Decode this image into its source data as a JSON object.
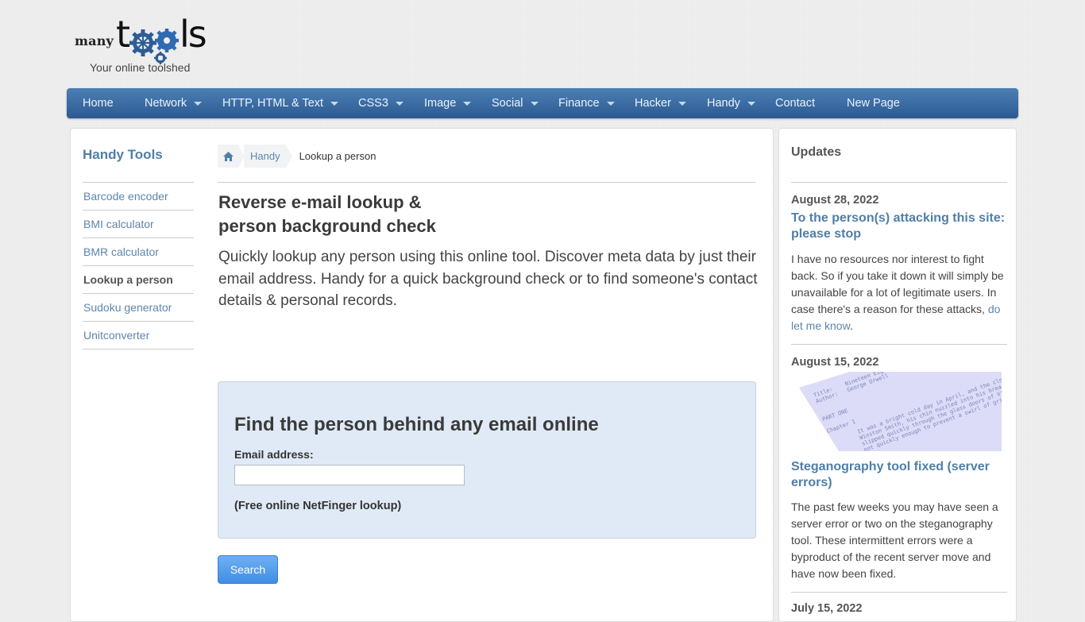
{
  "logo": {
    "word_many": "many",
    "word_t": "t",
    "word_ls": "ls",
    "tagline": "Your online toolshed"
  },
  "nav": {
    "items": [
      {
        "label": "Home",
        "dropdown": false
      },
      {
        "label": "Network",
        "dropdown": true
      },
      {
        "label": "HTTP, HTML & Text",
        "dropdown": true
      },
      {
        "label": "CSS3",
        "dropdown": true
      },
      {
        "label": "Image",
        "dropdown": true
      },
      {
        "label": "Social",
        "dropdown": true
      },
      {
        "label": "Finance",
        "dropdown": true
      },
      {
        "label": "Hacker",
        "dropdown": true
      },
      {
        "label": "Handy",
        "dropdown": true
      },
      {
        "label": "Contact",
        "dropdown": false
      },
      {
        "label": "New Page",
        "dropdown": false
      }
    ]
  },
  "sidebar": {
    "title": "Handy Tools",
    "items": [
      {
        "label": "Barcode encoder"
      },
      {
        "label": "BMI calculator"
      },
      {
        "label": "BMR calculator"
      },
      {
        "label": "Lookup a person",
        "active": true
      },
      {
        "label": "Sudoku generator"
      },
      {
        "label": "Unitconverter"
      }
    ]
  },
  "breadcrumb": {
    "home_icon": "home-icon",
    "parent": "Handy",
    "current": "Lookup a person"
  },
  "main": {
    "title_line1": "Reverse e-mail lookup &",
    "title_line2": "person background check",
    "intro": "Quickly lookup any person using this online tool. Discover meta data by just their email address. Handy for a quick background check or to find someone's contact details & personal records.",
    "form": {
      "heading": "Find the person behind any email online",
      "email_label": "Email address:",
      "email_value": "",
      "email_placeholder": "",
      "note": "(Free online NetFinger lookup)",
      "search_button": "Search"
    }
  },
  "updates": {
    "title": "Updates",
    "posts": [
      {
        "date": "August 28, 2022",
        "title": "To the person(s) attacking this site: please stop",
        "body": "I have no resources nor interest to fight back. So if you take it down it will simply be unavailable for a lot of legitimate users. In case there's a reason for these attacks, ",
        "link": "do let me know",
        "body_end": "."
      },
      {
        "date": "August 15, 2022",
        "image_text": {
          "title_label": "Title:",
          "author_label": "Author:",
          "title_value": "Nineteen Eighty-Four",
          "author_value": "George Orwell",
          "part": "PART ONE",
          "chapter": "Chapter 1",
          "lines": [
            "It was a bright cold day in April, and the clocks were striking",
            "Winston Smith, his chin nuzzled into his breast in an effort to",
            "slipped quickly through the glass doors of Victory Mansions",
            "not quickly enough to prevent a swirl of gritty dust from"
          ]
        },
        "title": "Steganography tool fixed (server errors)",
        "body": "The past few weeks you may have seen a server error or two on the steganography tool. These intermittent errors were a byproduct of the recent server move and have now been fixed."
      },
      {
        "date": "July 15, 2022"
      }
    ]
  },
  "colors": {
    "nav_top": "#4b7fb5",
    "nav_bottom": "#2d5a92",
    "link": "#4e7fa9",
    "form_bg": "#dfeaf6",
    "button": "#4a97ea"
  }
}
